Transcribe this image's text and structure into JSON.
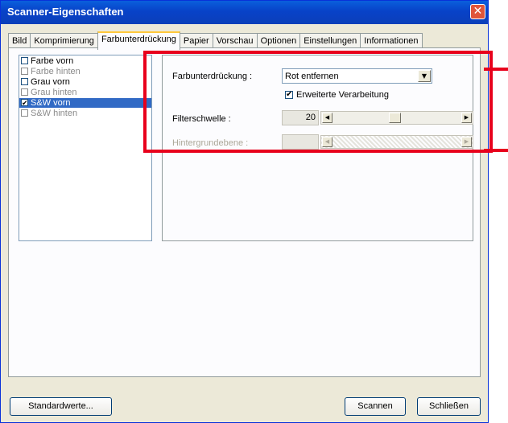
{
  "window": {
    "title": "Scanner-Eigenschaften",
    "close_glyph": "✕"
  },
  "tabs": [
    {
      "label": "Bild"
    },
    {
      "label": "Komprimierung"
    },
    {
      "label": "Farbunterdrückung",
      "active": true
    },
    {
      "label": "Papier"
    },
    {
      "label": "Vorschau"
    },
    {
      "label": "Optionen"
    },
    {
      "label": "Einstellungen"
    },
    {
      "label": "Informationen"
    }
  ],
  "image_list": [
    {
      "label": "Farbe vorn",
      "checked": false,
      "enabled": true,
      "selected": false
    },
    {
      "label": "Farbe hinten",
      "checked": false,
      "enabled": false,
      "selected": false
    },
    {
      "label": "Grau vorn",
      "checked": false,
      "enabled": true,
      "selected": false
    },
    {
      "label": "Grau hinten",
      "checked": false,
      "enabled": false,
      "selected": false
    },
    {
      "label": "S&W vorn",
      "checked": true,
      "enabled": true,
      "selected": true
    },
    {
      "label": "S&W hinten",
      "checked": false,
      "enabled": false,
      "selected": false
    }
  ],
  "settings": {
    "color_dropout_label": "Farbunterdrückung :",
    "color_dropout_value": "Rot entfernen",
    "advanced_label": "Erweiterte Verarbeitung",
    "advanced_checked": true,
    "threshold_label": "Filterschwelle :",
    "threshold_value": "20",
    "background_label": "Hintergrundebene :",
    "background_value": ""
  },
  "buttons": {
    "defaults": "Standardwerte...",
    "scan": "Scannen",
    "close": "Schließen"
  },
  "glyphs": {
    "checkmark": "✔",
    "dropdown": "▼",
    "left": "◀",
    "right": "▶"
  },
  "colors": {
    "highlight_box": "#e8001c",
    "selection": "#316ac5",
    "title_bar": "#0842c8"
  }
}
